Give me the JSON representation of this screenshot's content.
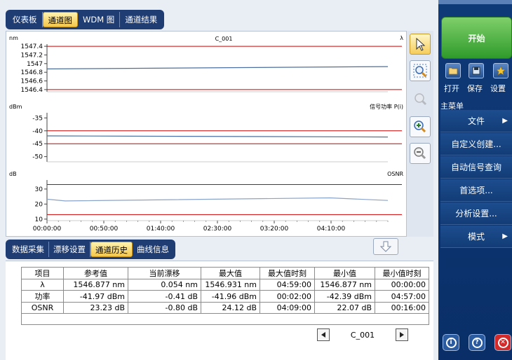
{
  "top_tabs": [
    {
      "label": "仪表板",
      "active": false
    },
    {
      "label": "通道图",
      "active": true
    },
    {
      "label": "WDM 图",
      "active": false
    },
    {
      "label": "通道结果",
      "active": false
    }
  ],
  "chart_header": {
    "channel": "C_001",
    "lambda_symbol": "λ"
  },
  "chart_data": [
    {
      "type": "line",
      "ylabel": "nm",
      "right_label": "λ",
      "y_ticks": [
        "1547.4",
        "1547.2",
        "1547",
        "1546.8",
        "1546.6",
        "1546.4"
      ],
      "ylim": [
        1546.35,
        1547.45
      ],
      "thresholds": [
        1547.4,
        1546.4
      ],
      "threshold_color": "#cc0000",
      "series_color": "#4a6fa0",
      "series": [
        {
          "x": [
            0,
            300
          ],
          "y": [
            1546.877,
            1546.931
          ]
        }
      ]
    },
    {
      "type": "line",
      "ylabel": "dBm",
      "right_label": "信号功率 P(i)",
      "y_ticks": [
        "-35",
        "-40",
        "-45",
        "-50"
      ],
      "ylim": [
        -52,
        -33
      ],
      "thresholds": [
        -40,
        -45
      ],
      "threshold_color": "#cc0000",
      "series_color": "#4a6fa0",
      "series": [
        {
          "x": [
            0,
            2,
            300
          ],
          "y": [
            -41.97,
            -41.96,
            -42.39
          ]
        }
      ]
    },
    {
      "type": "line",
      "ylabel": "dB",
      "right_label": "OSNR",
      "y_ticks": [
        "30",
        "20",
        "10"
      ],
      "ylim": [
        9,
        36
      ],
      "thresholds": [
        33,
        13
      ],
      "threshold_color": "#cc0000",
      "series_color": "#8aa3c9",
      "series": [
        {
          "x": [
            0,
            16,
            249,
            300
          ],
          "y": [
            23.23,
            22.07,
            24.12,
            22.4
          ]
        }
      ],
      "x_ticks": [
        "00:00:00",
        "00:50:00",
        "01:40:00",
        "02:30:00",
        "03:20:00",
        "04:10:00"
      ],
      "xlim": [
        0,
        300
      ]
    }
  ],
  "chart_tools": [
    {
      "name": "pointer-tool-icon",
      "active": true,
      "disabled": false
    },
    {
      "name": "zoom-area-icon",
      "active": false,
      "disabled": false
    },
    {
      "name": "zoom-reset-icon",
      "active": false,
      "disabled": true
    },
    {
      "name": "zoom-in-icon",
      "active": false,
      "disabled": false
    },
    {
      "name": "zoom-out-icon",
      "active": false,
      "disabled": false
    }
  ],
  "bottom_tabs": [
    {
      "label": "数据采集",
      "active": false
    },
    {
      "label": "漂移设置",
      "active": false
    },
    {
      "label": "通道历史",
      "active": true
    },
    {
      "label": "曲线信息",
      "active": false
    }
  ],
  "table": {
    "headers": [
      "项目",
      "参考值",
      "当前漂移",
      "最大值",
      "最大值时刻",
      "最小值",
      "最小值时刻"
    ],
    "rows": [
      [
        "λ",
        "1546.877 nm",
        "0.054 nm",
        "1546.931 nm",
        "04:59:00",
        "1546.877 nm",
        "00:00:00"
      ],
      [
        "功率",
        "-41.97 dBm",
        "-0.41 dB",
        "-41.96 dBm",
        "00:02:00",
        "-42.39 dBm",
        "04:57:00"
      ],
      [
        "OSNR",
        "23.23 dB",
        "-0.80 dB",
        "24.12 dB",
        "04:09:00",
        "22.07 dB",
        "00:16:00"
      ]
    ]
  },
  "channel_selector": {
    "value": "C_001"
  },
  "right_panel": {
    "start_label": "开始",
    "quick_actions": [
      {
        "label": "打开",
        "icon": "folder-open-icon"
      },
      {
        "label": "保存",
        "icon": "save-icon"
      },
      {
        "label": "设置",
        "icon": "star-icon"
      }
    ],
    "menu_title": "主菜单",
    "menu_items": [
      {
        "label": "文件",
        "has_arrow": true
      },
      {
        "label": "自定义创建...",
        "has_arrow": false
      },
      {
        "label": "自动信号查询",
        "has_arrow": false
      },
      {
        "label": "首选项...",
        "has_arrow": false
      },
      {
        "label": "分析设置...",
        "has_arrow": false
      },
      {
        "label": "模式",
        "has_arrow": true
      }
    ],
    "bottom_buttons": [
      {
        "icon": "info-icon",
        "glyph": "i",
        "color": "#2a5aa0"
      },
      {
        "icon": "help-icon",
        "glyph": "?",
        "color": "#2a5aa0"
      },
      {
        "icon": "close-icon",
        "glyph": "✕",
        "color": "#d42a2a"
      }
    ]
  }
}
